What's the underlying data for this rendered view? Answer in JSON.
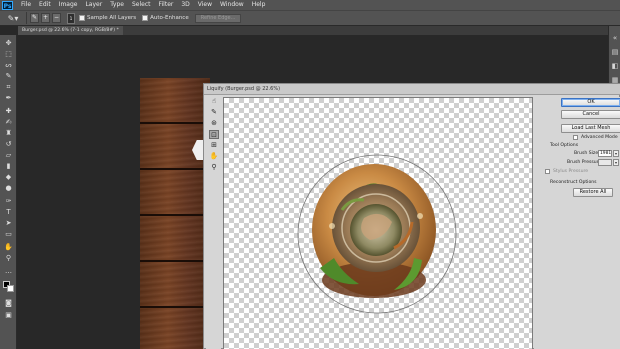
{
  "app": {
    "logo": "Ps",
    "menu": [
      "File",
      "Edit",
      "Image",
      "Layer",
      "Type",
      "Select",
      "Filter",
      "3D",
      "View",
      "Window",
      "Help"
    ]
  },
  "options": {
    "brush_size": "1",
    "sample_all_layers": "Sample All Layers",
    "auto_enhance": "Auto-Enhance",
    "refine_edge": "Refine Edge..."
  },
  "document": {
    "tab_title": "Burger.psd @ 22.6% (7-1 copy, RGB/8#) *"
  },
  "liquify": {
    "title": "Liquify (Burger.psd @ 22.6%)",
    "ok": "OK",
    "cancel": "Cancel",
    "load_last_mesh": "Load Last Mesh",
    "advanced_mode": "Advanced Mode",
    "tool_options": "Tool Options",
    "brush_size_label": "Brush Size:",
    "brush_size_value": "1981",
    "brush_pressure_label": "Brush Pressure:",
    "brush_pressure_value": "",
    "stylus_pressure": "Stylus Pressure",
    "reconstruct_options": "Reconstruct Options",
    "restore_all": "Restore All"
  },
  "colors": {
    "ui_dark": "#282828",
    "ui_panel": "#535353",
    "dialog_bg": "#d6d6d6",
    "wood": "#6a3a1e",
    "accent": "#3b73c4"
  },
  "icons": {
    "toolbox": [
      "move-icon",
      "marquee-icon",
      "lasso-icon",
      "quick-selection-icon",
      "crop-icon",
      "eyedropper-icon",
      "healing-brush-icon",
      "brush-icon",
      "clone-stamp-icon",
      "history-brush-icon",
      "eraser-icon",
      "gradient-icon",
      "blur-icon",
      "dodge-icon",
      "pen-icon",
      "type-icon",
      "path-selection-icon",
      "shape-icon",
      "hand-icon",
      "zoom-icon"
    ],
    "liquify_tools": [
      "forward-warp-icon",
      "reconstruct-icon",
      "twirl-icon",
      "pucker-icon",
      "bloat-icon",
      "hand-icon",
      "zoom-icon"
    ]
  }
}
